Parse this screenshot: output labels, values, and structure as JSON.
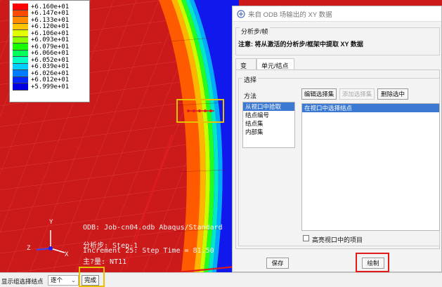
{
  "legend": {
    "entries": [
      {
        "label": "+6.160e+01",
        "color": "#ff0000"
      },
      {
        "label": "+6.147e+01",
        "color": "#ff4a00"
      },
      {
        "label": "+6.133e+01",
        "color": "#ff8c00"
      },
      {
        "label": "+6.120e+01",
        "color": "#ffc400"
      },
      {
        "label": "+6.106e+01",
        "color": "#e0ff00"
      },
      {
        "label": "+6.093e+01",
        "color": "#8cff00"
      },
      {
        "label": "+6.079e+01",
        "color": "#1aff00"
      },
      {
        "label": "+6.066e+01",
        "color": "#00ff5a"
      },
      {
        "label": "+6.052e+01",
        "color": "#00ffc4"
      },
      {
        "label": "+6.039e+01",
        "color": "#00d0ff"
      },
      {
        "label": "+6.026e+01",
        "color": "#007cff"
      },
      {
        "label": "+6.012e+01",
        "color": "#0028ff"
      },
      {
        "label": "+5.999e+01",
        "color": "#0000e0"
      }
    ]
  },
  "viewport_info": {
    "odb_line": "ODB: Job-cn04.odb    Abaqus/Standard",
    "step_line": "分析步: Step-1",
    "increment_line": "Increment    25: Step Time =    81.50",
    "var_line": "主?量: NT11"
  },
  "triad": {
    "x": "X",
    "y": "Y",
    "z": "Z"
  },
  "dialog": {
    "title": "来自 ODB 场输出的 XY 数据",
    "step_frame_label": "分析步/帧",
    "note_label": "注意: 将从激活的分析步/框架中提取 XY 数据",
    "tabs": [
      {
        "label": "变量",
        "active": false
      },
      {
        "label": "单元/结点",
        "active": true
      }
    ],
    "selection_label": "选择",
    "method_label": "方法",
    "methods": [
      {
        "label": "从视口中拾取",
        "selected": true
      },
      {
        "label": "结点编号",
        "selected": false
      },
      {
        "label": "结点集",
        "selected": false
      },
      {
        "label": "内部集",
        "selected": false
      }
    ],
    "edit_selection_button": "编辑选择集",
    "add_selection_button": "添加选择集",
    "delete_selection_button": "删除选中",
    "selection_items": [
      "在视口中选择结点"
    ],
    "highlight_checkbox_label": "高亮视口中的项目",
    "save_button": "保存",
    "plot_button": "绘制"
  },
  "bottombar": {
    "prompt_label": "显示组选择结点",
    "mode_value": "逐个",
    "done_button": "完成"
  },
  "colors": {
    "model_red": "#cc1a1a",
    "highlight_yellow": "#e8c200",
    "annotation_red": "#e11b1b",
    "selection_blue": "#3b79d3"
  }
}
